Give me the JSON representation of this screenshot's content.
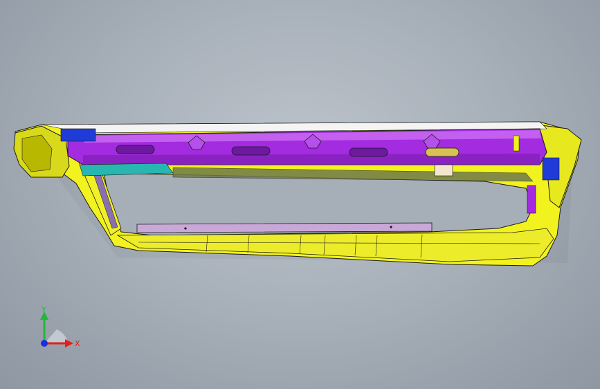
{
  "viewport": {
    "background_colors": [
      "#bcc3cb",
      "#8e97a2"
    ]
  },
  "model": {
    "part_colors": {
      "frame": "#f2f21f",
      "frame_dark": "#b8b800",
      "beam": "#a32be0",
      "beam_light": "#c96af2",
      "accent_blue": "#1f3bd8",
      "accent_cyan": "#28b6b0",
      "outline": "#1a1a1a"
    }
  },
  "triad": {
    "x_label": "X",
    "y_label": "Y",
    "x_color": "#e0201c",
    "y_color": "#1fb83a",
    "z_color": "#1c2fe0"
  }
}
